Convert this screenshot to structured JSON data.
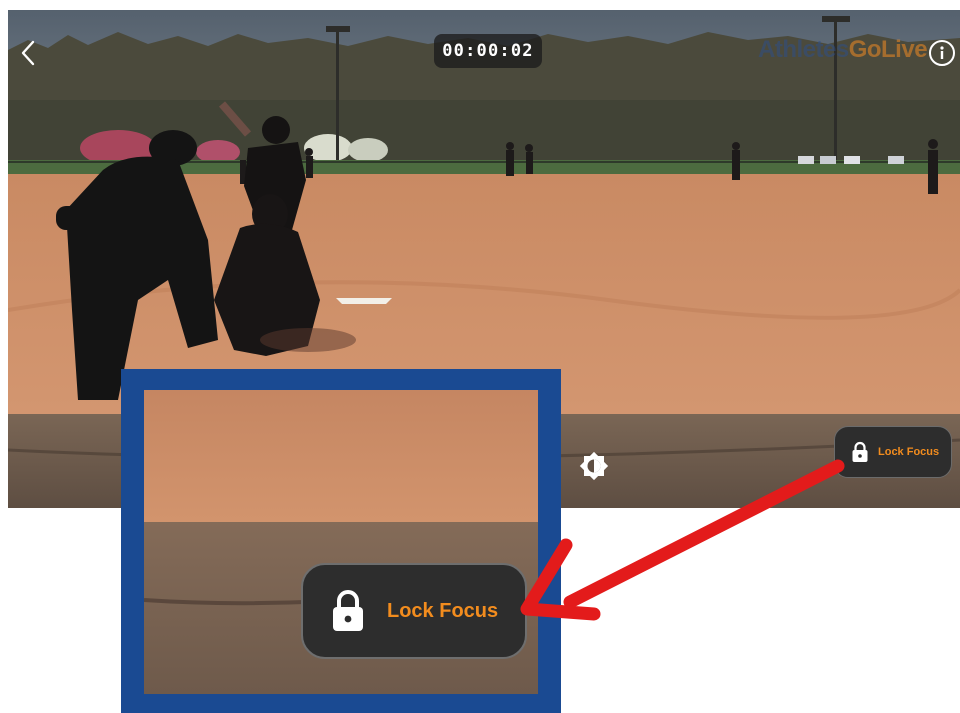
{
  "camera": {
    "timer": "00:00:02",
    "brand": {
      "part1": "Athletes",
      "part2": "GoLive"
    }
  },
  "controls": {
    "lock_focus_label": "Lock Focus"
  },
  "zoom_callout": {
    "lock_focus_label": "Lock Focus"
  },
  "colors": {
    "accent_orange": "#f28c1e",
    "callout_border": "#1a4a92",
    "arrow_red": "#e31b1b"
  },
  "icons": [
    "back-chevron-icon",
    "info-icon",
    "exposure-icon",
    "lock-icon"
  ]
}
